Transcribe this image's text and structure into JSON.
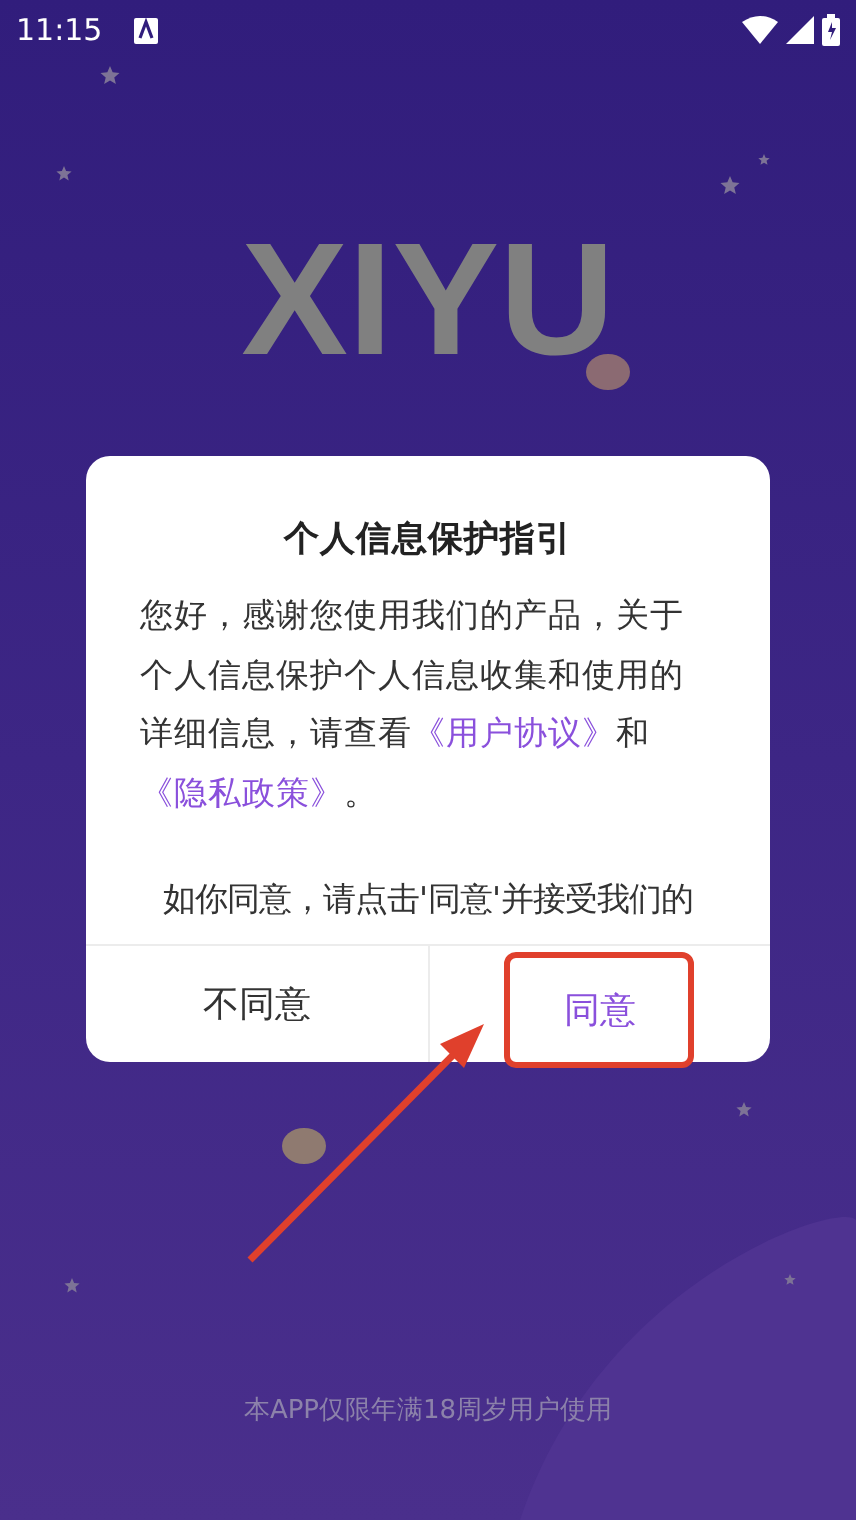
{
  "status_bar": {
    "time": "11:15"
  },
  "logo": {
    "text": "XIYU"
  },
  "dialog": {
    "title": "个人信息保护指引",
    "body": [
      {
        "kind": "text",
        "text": "您好，感谢您使用我们的产品，关于个人信息保护个人信息收集和使用的详细信息，请查看"
      },
      {
        "kind": "link",
        "text": "《用户协议》"
      },
      {
        "kind": "text",
        "text": "和"
      },
      {
        "kind": "link",
        "text": "《隐私政策》"
      },
      {
        "kind": "text",
        "text": "。"
      }
    ],
    "body_2": "如你同意，请点击'同意'并接受我们的",
    "buttons": [
      {
        "label": "不同意",
        "primary": false
      },
      {
        "label": "同意",
        "primary": true
      }
    ]
  },
  "footer": "本APP仅限年满18周岁用户使用"
}
